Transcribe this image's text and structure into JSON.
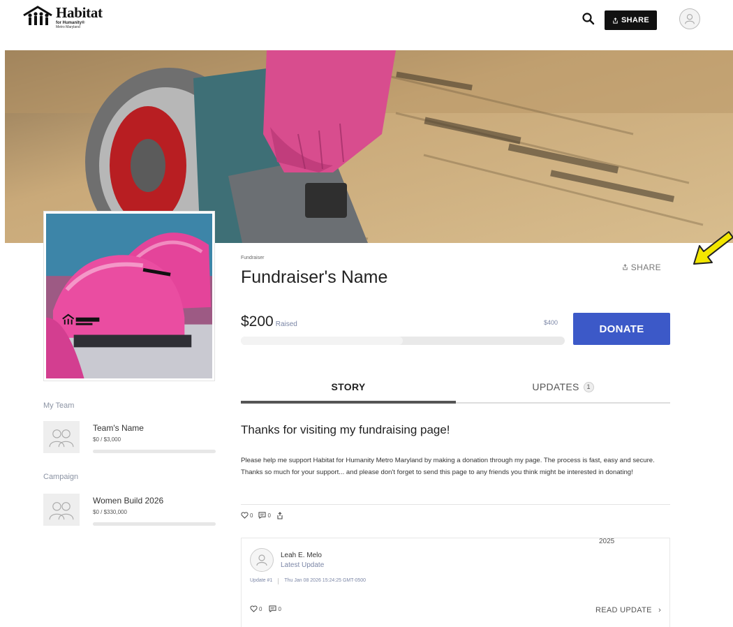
{
  "header": {
    "logo": {
      "main": "Habitat",
      "sub": "for Humanity®",
      "sub2": "Metro Maryland"
    },
    "share_label": "SHARE"
  },
  "sidebar": {
    "my_team_label": "My Team",
    "team": {
      "name": "Team's Name",
      "amount": "$0 / $3,000",
      "progress": 0
    },
    "campaign_label": "Campaign",
    "campaign": {
      "name": "Women Build 2026",
      "amount": "$0 / $330,000",
      "progress": 0
    }
  },
  "fundraiser": {
    "kicker": "Fundraiser",
    "name": "Fundraiser's Name",
    "share_label": "SHARE",
    "raised": "$200",
    "raised_label": "Raised",
    "goal": "$400",
    "progress_fraction": 0.5,
    "donate_label": "DONATE"
  },
  "tabs": {
    "story": "STORY",
    "updates": "UPDATES",
    "updates_count": "1"
  },
  "story": {
    "title": "Thanks for visiting my fundraising page!",
    "body": "Please help me support Habitat for Humanity Metro Maryland by making a donation through my page. The process is fast, easy and secure. Thanks so much for your support... and please don't forget to send this page to any friends you think might be interested in donating!",
    "likes": "0",
    "comments": "0"
  },
  "update": {
    "author": "Leah E. Melo",
    "label": "Latest Update",
    "number": "Update #1",
    "date": "Thu Jan 08 2026 15:24:25 GMT-0500",
    "likes": "0",
    "comments": "0",
    "read_label": "READ UPDATE"
  },
  "annotation": {
    "year": "2025"
  },
  "colors": {
    "accent": "#3c59c8",
    "muted": "#7b86a6",
    "arrow": "#f2e600"
  }
}
